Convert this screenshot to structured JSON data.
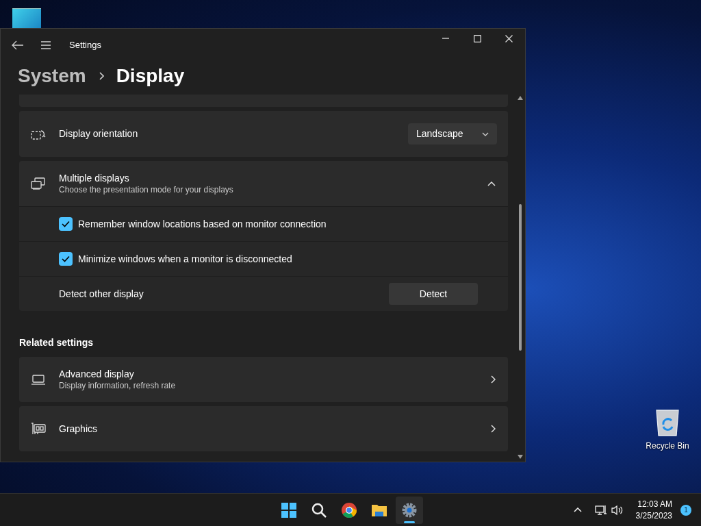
{
  "window": {
    "title": "Settings",
    "breadcrumb": [
      {
        "label": "System",
        "selected": false
      },
      {
        "label": "Display",
        "selected": true
      }
    ]
  },
  "settings": [
    {
      "kind": "dropdown",
      "label": "Display orientation",
      "value": "Landscape"
    },
    {
      "kind": "expander",
      "label": "Multiple displays",
      "description": "Choose the presentation mode for your displays",
      "expanded": true,
      "options": [
        {
          "kind": "checkbox",
          "label": "Remember window locations based on monitor connection",
          "checked": true
        },
        {
          "kind": "checkbox",
          "label": "Minimize windows when a monitor is disconnected",
          "checked": true
        },
        {
          "kind": "button",
          "label": "Detect other display",
          "button": "Detect"
        }
      ]
    }
  ],
  "related": {
    "heading": "Related settings",
    "items": [
      {
        "kind": "laptop",
        "label": "Advanced display",
        "description": "Display information, refresh rate"
      },
      {
        "kind": "gpu",
        "label": "Graphics"
      }
    ]
  },
  "desktop_icons": [
    {
      "label": "Recycle Bin"
    }
  ],
  "taskbar": {
    "apps": [
      {
        "kind": "start",
        "selected": false
      },
      {
        "kind": "search",
        "selected": false
      },
      {
        "kind": "browser",
        "selected": false
      },
      {
        "kind": "folder",
        "selected": false
      },
      {
        "kind": "settings",
        "selected": true
      }
    ],
    "time": "12:03 AM",
    "date": "3/25/2023",
    "notification_count": "1"
  }
}
